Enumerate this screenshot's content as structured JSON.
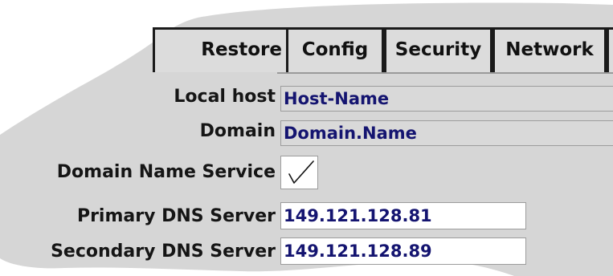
{
  "tabs": [
    {
      "id": "restore",
      "label": "Restore"
    },
    {
      "id": "config",
      "label": "Config"
    },
    {
      "id": "security",
      "label": "Security"
    },
    {
      "id": "network",
      "label": "Network"
    }
  ],
  "form": {
    "local_host": {
      "label": "Local host",
      "value": "Host-Name"
    },
    "domain": {
      "label": "Domain",
      "value": "Domain.Name"
    },
    "dns_service": {
      "label": "Domain Name Service",
      "checked": true
    },
    "primary_dns": {
      "label": "Primary DNS Server",
      "value": "149.121.128.81"
    },
    "secondary_dns": {
      "label": "Secondary DNS Server",
      "value": "149.121.128.89"
    }
  },
  "colors": {
    "panel": "#d9d9d9",
    "field_text": "#141470",
    "tab_border": "#1a1a1a"
  }
}
